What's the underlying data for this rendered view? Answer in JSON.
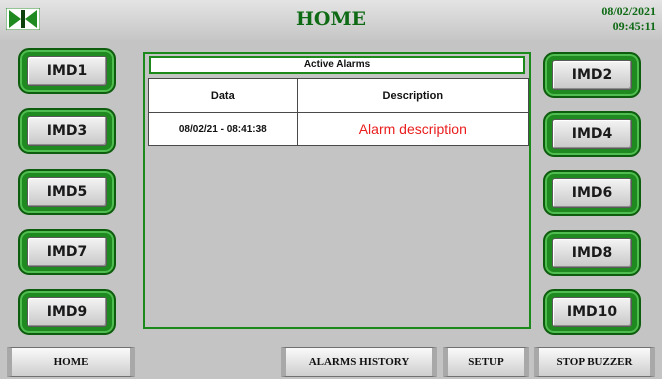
{
  "header": {
    "title": "HOME",
    "date": "08/02/2021",
    "time": "09:45:11",
    "logo_icon": "company-logo-icon"
  },
  "imd_buttons": {
    "left": [
      "IMD1",
      "IMD3",
      "IMD5",
      "IMD7",
      "IMD9"
    ],
    "right": [
      "IMD2",
      "IMD4",
      "IMD6",
      "IMD8",
      "IMD10"
    ]
  },
  "alarms_panel": {
    "title": "Active Alarms",
    "columns": [
      "Data",
      "Description"
    ],
    "rows": [
      {
        "date": "08/02/21 - 08:41:38",
        "description": "Alarm description"
      }
    ]
  },
  "nav": {
    "home": "HOME",
    "alarms_history": "ALARMS HISTORY",
    "setup": "SETUP",
    "stop_buzzer": "STOP BUZZER"
  },
  "colors": {
    "accent_green": "#1f8a1f",
    "title_green": "#0f6a15",
    "alarm_red": "#ea1d1d",
    "background": "#c4c4c4"
  }
}
